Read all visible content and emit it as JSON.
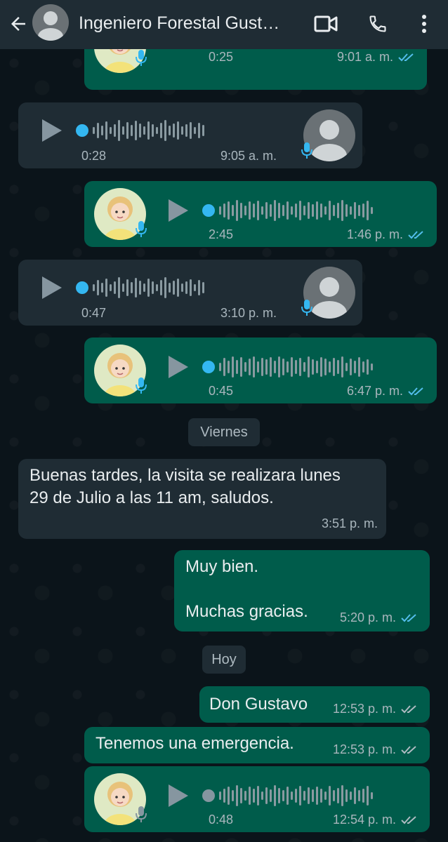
{
  "header": {
    "title": "Ingeniero Forestal Gust…"
  },
  "messages": [
    {
      "dur": "0:25",
      "time": "9:01 a. m."
    },
    {
      "dur": "0:28",
      "time": "9:05 a. m."
    },
    {
      "dur": "2:45",
      "time": "1:46 p. m."
    },
    {
      "dur": "0:47",
      "time": "3:10 p. m."
    },
    {
      "dur": "0:45",
      "time": "6:47 p. m."
    },
    {
      "text_line1": "Buenas tardes, la visita se realizara lunes",
      "text_line2": "29 de Julio a las 11 am, saludos.",
      "time": "3:51 p. m."
    },
    {
      "text_line1": "Muy bien.",
      "text_line2": "Muchas gracias.",
      "time": "5:20 p. m."
    },
    {
      "text": "Don Gustavo",
      "time": "12:53 p. m."
    },
    {
      "text": "Tenemos una emergencia.",
      "time": "12:53 p. m."
    },
    {
      "dur": "0:48",
      "time": "12:54 p. m."
    }
  ],
  "dates": {
    "friday": "Viernes",
    "today": "Hoy"
  },
  "colors": {
    "outgoing_bubble": "#005c4b",
    "incoming_bubble": "#1f2c34",
    "read_tick": "#53bdeb",
    "played_dot": "#34b7f1"
  },
  "icons": [
    "back-arrow-icon",
    "video-call-icon",
    "phone-icon",
    "more-options-icon",
    "play-icon",
    "microphone-icon",
    "double-check-icon"
  ]
}
